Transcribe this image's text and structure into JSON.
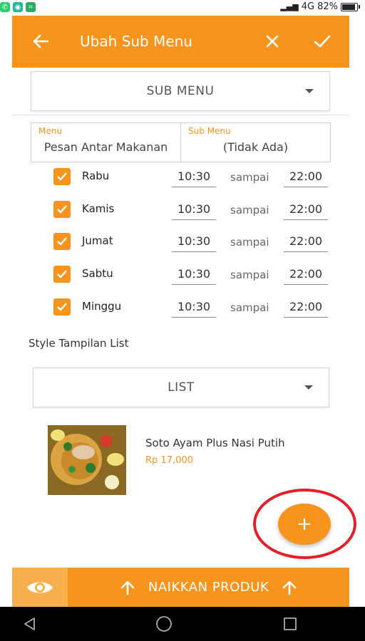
{
  "status_bar": {
    "network": "4G",
    "battery": "82%",
    "battery_level": 0.82,
    "icons": [
      "whatsapp-icon",
      "app-icon",
      "scan-icon"
    ]
  },
  "appbar": {
    "title": "Ubah Sub Menu",
    "icons": [
      "back-arrow-icon",
      "close-icon",
      "check-icon"
    ]
  },
  "sub_menu_dropdown": {
    "selected": "SUB MENU"
  },
  "menu_box": {
    "label": "Menu",
    "value": "Pesan Antar Makanan"
  },
  "submenu_box": {
    "label": "Sub Menu",
    "value": "(Tidak Ada)"
  },
  "schedule": {
    "until_label": "sampai",
    "days": [
      {
        "day": "Rabu",
        "checked": true,
        "start": "10:30",
        "end": "22:00"
      },
      {
        "day": "Kamis",
        "checked": true,
        "start": "10:30",
        "end": "22:00"
      },
      {
        "day": "Jumat",
        "checked": true,
        "start": "10:30",
        "end": "22:00"
      },
      {
        "day": "Sabtu",
        "checked": true,
        "start": "10:30",
        "end": "22:00"
      },
      {
        "day": "Minggu",
        "checked": true,
        "start": "10:30",
        "end": "22:00"
      }
    ]
  },
  "list_style": {
    "label": "Style Tampilan List",
    "selected": "LIST"
  },
  "product": {
    "name": "Soto Ayam Plus Nasi Putih",
    "price": "Rp 17,000"
  },
  "fab": {
    "icon": "plus-icon",
    "symbol": "+"
  },
  "bottom_bar": {
    "preview_icon": "eye-icon",
    "raise_label": "NAIKKAN PRODUK"
  },
  "colors": {
    "accent": "#F7941D",
    "accent_light": "#F8B04E",
    "highlight": "#e3202a"
  }
}
